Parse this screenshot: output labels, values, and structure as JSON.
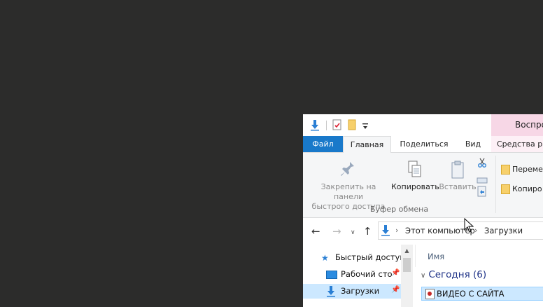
{
  "titlebar": {
    "contextual_title": "Воспро"
  },
  "tabs": {
    "file": "Файл",
    "home": "Главная",
    "share": "Поделиться",
    "view": "Вид",
    "contextual": "Средства ра"
  },
  "ribbon": {
    "pin_line1": "Закрепить на панели",
    "pin_line2": "быстрого доступа",
    "copy": "Копировать",
    "paste": "Вставить",
    "clipboard_group": "Буфер обмена",
    "move_to": "Переме",
    "copy_to": "Копиро"
  },
  "address": {
    "this_pc": "Этот компьютер",
    "downloads": "Загрузки"
  },
  "navpane": {
    "items": [
      {
        "label": "Быстрый доступ"
      },
      {
        "label": "Рабочий сто"
      },
      {
        "label": "Загрузки"
      }
    ]
  },
  "list": {
    "column_name": "Имя",
    "group": "Сегодня (6)",
    "file": "ВИДЕО С САЙТА"
  },
  "colors": {
    "desktop": "#2c2c2b",
    "file_tab": "#1979ca",
    "contextual": "#f7d7e6",
    "selection": "#cce8ff",
    "group_header": "#1e3287"
  }
}
